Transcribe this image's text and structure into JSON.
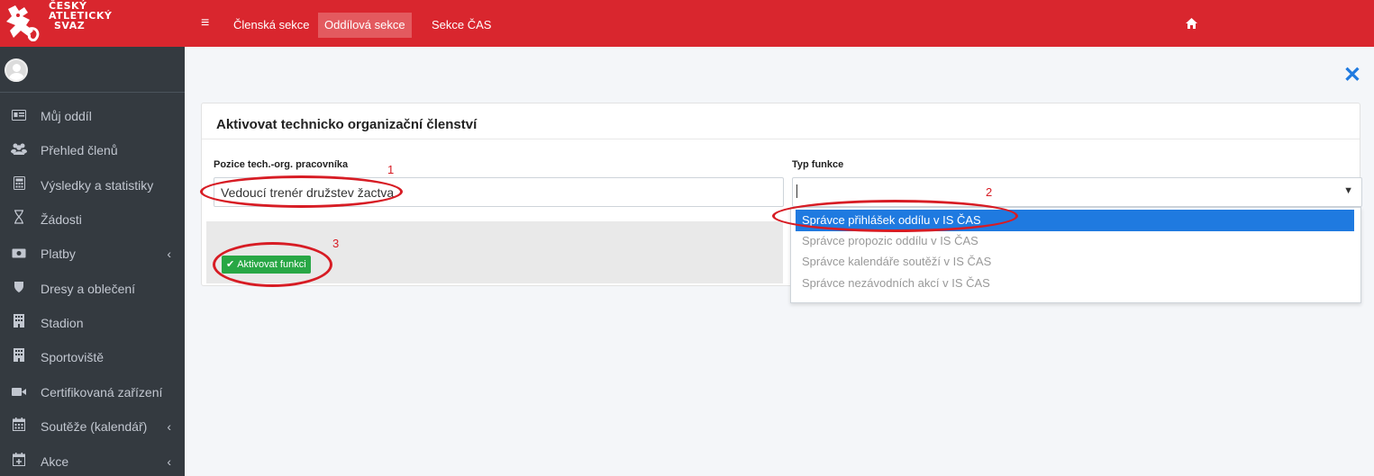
{
  "brand": {
    "logo_lines": [
      "ČESKÝ",
      "ATLETICKÝ",
      "SVAZ"
    ]
  },
  "topbar": {
    "menu_icon": "hamburger-icon",
    "links": [
      "Členská sekce",
      "Oddílová sekce",
      "Sekce ČAS"
    ],
    "active_link": "Oddílová sekce",
    "home_icon": "home-icon"
  },
  "sidebar": {
    "items": [
      {
        "label": "Můj oddíl",
        "icon": "id-card-icon"
      },
      {
        "label": "Přehled členů",
        "icon": "users-icon"
      },
      {
        "label": "Výsledky a statistiky",
        "icon": "calculator-icon"
      },
      {
        "label": "Žádosti",
        "icon": "hourglass-icon"
      },
      {
        "label": "Platby",
        "icon": "money-icon",
        "has_arrow": true
      },
      {
        "label": "Dresy a oblečení",
        "icon": "shield-icon"
      },
      {
        "label": "Stadion",
        "icon": "building-icon"
      },
      {
        "label": "Sportoviště",
        "icon": "building-icon"
      },
      {
        "label": "Certifikovaná zařízení",
        "icon": "video-camera-icon"
      },
      {
        "label": "Soutěže (kalendář)",
        "icon": "calendar-icon",
        "has_arrow": true
      },
      {
        "label": "Akce",
        "icon": "calendar-plus-icon",
        "has_arrow": true
      }
    ]
  },
  "form": {
    "title": "Aktivovat technicko organizační členství",
    "position_label": "Pozice tech.-org. pracovníka",
    "position_value": "Vedoucí trenér družstev žactva",
    "function_type_label": "Typ funkce",
    "submit_label": "Aktivovat funkci"
  },
  "dropdown": {
    "options": [
      "Správce přihlášek oddílu v IS ČAS",
      "Správce propozic oddílu v IS ČAS",
      "Správce kalendáře soutěží v IS ČAS",
      "Správce nezávodních akcí v IS ČAS"
    ],
    "highlighted": "Správce přihlášek oddílu v IS ČAS"
  },
  "annotations": [
    "1",
    "2",
    "3"
  ],
  "colors": {
    "brand_red": "#d9262e",
    "sidebar_bg": "#343a40",
    "primary_blue": "#1f7ae0",
    "success_green": "#28a745",
    "annotation_red": "#d71c24"
  }
}
